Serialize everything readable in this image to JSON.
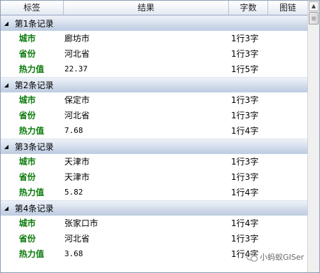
{
  "columns": {
    "tag": "标签",
    "result": "结果",
    "count": "字数",
    "image": "图链"
  },
  "groups": [
    {
      "title": "第1条记录",
      "rows": [
        {
          "tag": "城市",
          "result": "廊坊市",
          "count": "1行3字"
        },
        {
          "tag": "省份",
          "result": "河北省",
          "count": "1行3字"
        },
        {
          "tag": "热力值",
          "result": "22.37",
          "count": "1行5字"
        }
      ]
    },
    {
      "title": "第2条记录",
      "rows": [
        {
          "tag": "城市",
          "result": "保定市",
          "count": "1行3字"
        },
        {
          "tag": "省份",
          "result": "河北省",
          "count": "1行3字"
        },
        {
          "tag": "热力值",
          "result": "7.68",
          "count": "1行4字"
        }
      ]
    },
    {
      "title": "第3条记录",
      "rows": [
        {
          "tag": "城市",
          "result": "天津市",
          "count": "1行3字"
        },
        {
          "tag": "省份",
          "result": "天津市",
          "count": "1行3字"
        },
        {
          "tag": "热力值",
          "result": "5.82",
          "count": "1行4字"
        }
      ]
    },
    {
      "title": "第4条记录",
      "rows": [
        {
          "tag": "城市",
          "result": "张家口市",
          "count": "1行4字"
        },
        {
          "tag": "省份",
          "result": "河北省",
          "count": "1行3字"
        },
        {
          "tag": "热力值",
          "result": "3.68",
          "count": "1行4字"
        }
      ]
    }
  ],
  "watermark": {
    "text": "小蚂蚁GISer"
  },
  "colors": {
    "tag": "#0a7a0a",
    "group_band": "#cfdaea",
    "border": "#8c9db5"
  },
  "icons": {
    "expand": "triangle-down-icon",
    "scroll_up": "chevron-up-icon",
    "watermark": "wechat-icon"
  }
}
